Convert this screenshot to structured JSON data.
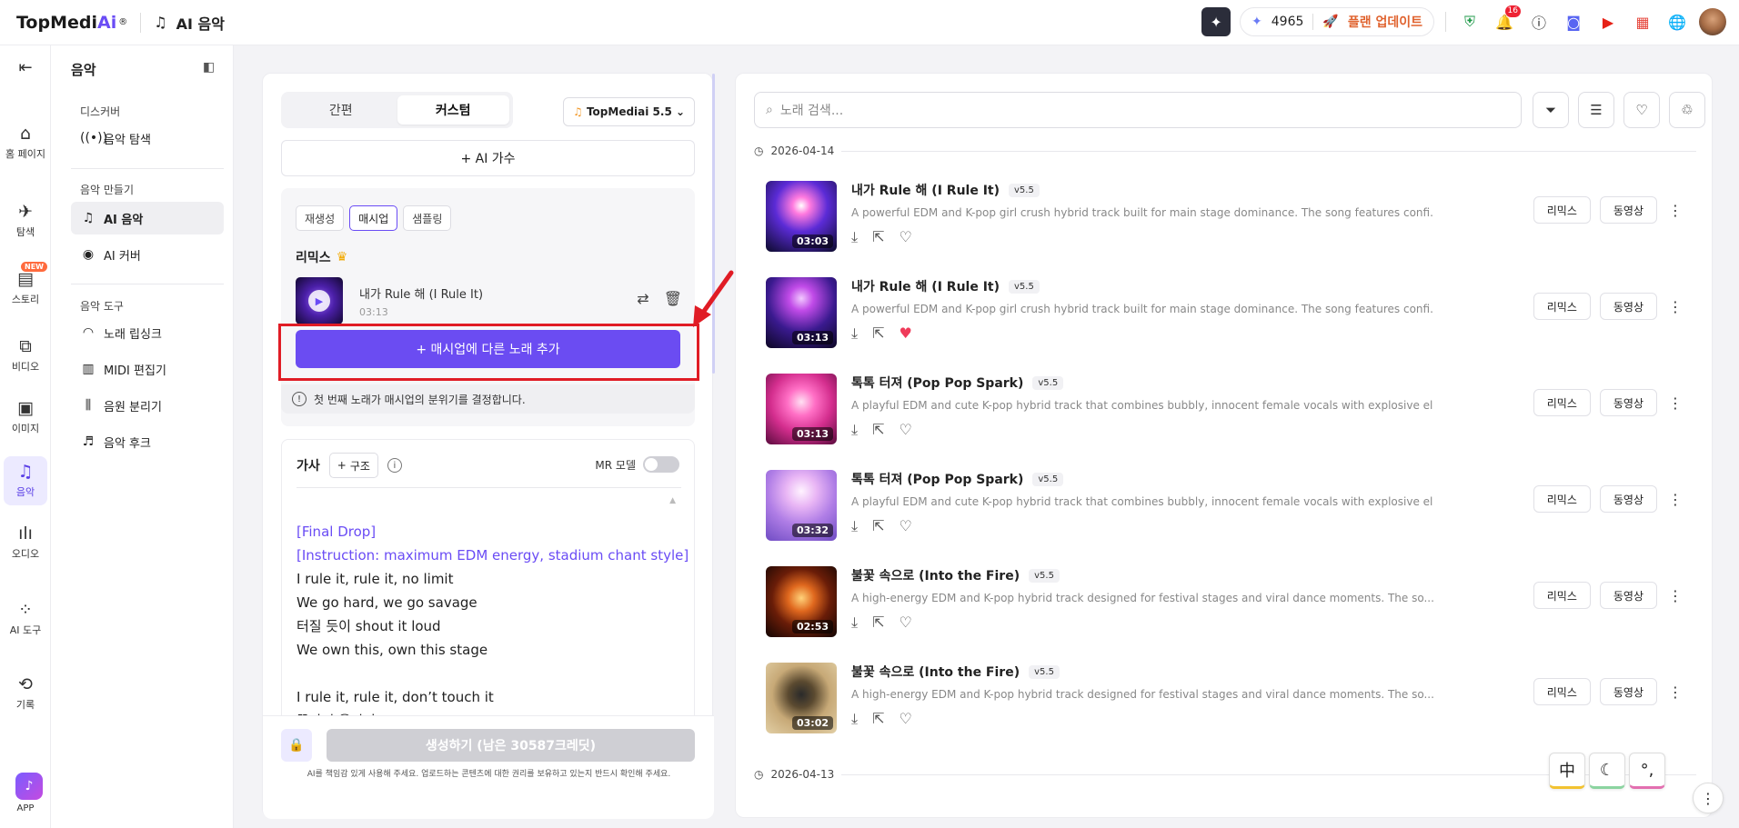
{
  "topbar": {
    "brand": "TopMedi",
    "brand_ai": "Ai",
    "brand_mark": "®",
    "app_title": "AI 음악",
    "credits": "4965",
    "upgrade": "플랜 업데이트",
    "notification_count": "16"
  },
  "rail": {
    "items": [
      {
        "label": "홈 페이지",
        "icon": "home-icon"
      },
      {
        "label": "탐색",
        "icon": "explore-icon"
      },
      {
        "label": "스토리",
        "icon": "story-icon",
        "tag": "NEW"
      },
      {
        "label": "비디오",
        "icon": "video-icon"
      },
      {
        "label": "이미지",
        "icon": "image-icon"
      },
      {
        "label": "음악",
        "icon": "music-icon"
      },
      {
        "label": "오디오",
        "icon": "audio-icon"
      },
      {
        "label": "AI 도구",
        "icon": "ai-tools-icon"
      },
      {
        "label": "기록",
        "icon": "history-icon"
      }
    ],
    "app_label": "APP"
  },
  "sidebar": {
    "title": "음악",
    "discover_section": "디스커버",
    "discover_items": [
      "음악 탐색"
    ],
    "make_section": "음악 만들기",
    "make_items": [
      "AI 음악",
      "AI 커버"
    ],
    "tools_section": "음악 도구",
    "tools_items": [
      "노래 립싱크",
      "MIDI 편집기",
      "음원 분리기",
      "음악 후크"
    ]
  },
  "left": {
    "tabs": [
      "간편",
      "커스텀"
    ],
    "model": "TopMediai 5.5",
    "ai_singer": "+ AI 가수",
    "subtabs": [
      "재생성",
      "매시업",
      "샘플링"
    ],
    "remix_title": "리믹스",
    "track": {
      "title": "내가 Rule 해 (I Rule It)",
      "duration": "03:13"
    },
    "add_button": "+ 매시업에 다른 노래 추가",
    "note": "첫 번째 노래가 매시업의 분위기를 결정합니다.",
    "lyrics_title": "가사",
    "structure_button": "구조",
    "mr_label": "MR 모델",
    "lyrics_tags": [
      "[Final Drop]",
      "[Instruction: maximum EDM energy, stadium chant style]"
    ],
    "lyrics_lines_a": [
      "I rule it, rule it, no limit",
      "We go hard, we go savage",
      "터질 듯이 shout it loud",
      "We own this, own this stage"
    ],
    "lyrics_lines_b": [
      "I rule it, rule it, don’t touch it",
      "끝까지 올라가"
    ],
    "generate_button": "생성하기 (남은 30587크레딧)",
    "disclaimer": "AI를 책임감 있게 사용해 주세요. 업로드하는 콘텐츠에 대한 권리를 보유하고 있는지 반드시 확인해 주세요."
  },
  "right": {
    "search_placeholder": "노래 검색...",
    "date1": "2026-04-14",
    "date2": "2026-04-13",
    "remix_label": "리믹스",
    "video_label": "동영상",
    "songs": [
      {
        "title": "내가 Rule 해 (I Rule It)",
        "version": "v5.5",
        "desc": "A powerful EDM and K-pop girl crush hybrid track built for main stage dominance. The song features confi...",
        "duration": "03:03",
        "liked": false
      },
      {
        "title": "내가 Rule 해 (I Rule It)",
        "version": "v5.5",
        "desc": "A powerful EDM and K-pop girl crush hybrid track built for main stage dominance. The song features confi...",
        "duration": "03:13",
        "liked": true
      },
      {
        "title": "톡톡 터져 (Pop Pop Spark)",
        "version": "v5.5",
        "desc": "A playful EDM and cute K-pop hybrid track that combines bubbly, innocent female vocals with explosive el...",
        "duration": "03:13",
        "liked": false
      },
      {
        "title": "톡톡 터져 (Pop Pop Spark)",
        "version": "v5.5",
        "desc": "A playful EDM and cute K-pop hybrid track that combines bubbly, innocent female vocals with explosive el...",
        "duration": "03:32",
        "liked": false
      },
      {
        "title": "불꽃 속으로 (Into the Fire)",
        "version": "v5.5",
        "desc": "A high-energy EDM and K-pop hybrid track designed for festival stages and viral dance moments. The so...",
        "duration": "02:53",
        "liked": false
      },
      {
        "title": "불꽃 속으로 (Into the Fire)",
        "version": "v5.5",
        "desc": "A high-energy EDM and K-pop hybrid track designed for festival stages and viral dance moments. The so...",
        "duration": "03:02",
        "liked": false
      }
    ]
  },
  "float": {
    "lang": "中",
    "moon": "☾",
    "punct": "°,"
  },
  "colors": {
    "accent": "#6b4cf2",
    "highlight": "#e01c25",
    "like": "#ef3b5a"
  }
}
